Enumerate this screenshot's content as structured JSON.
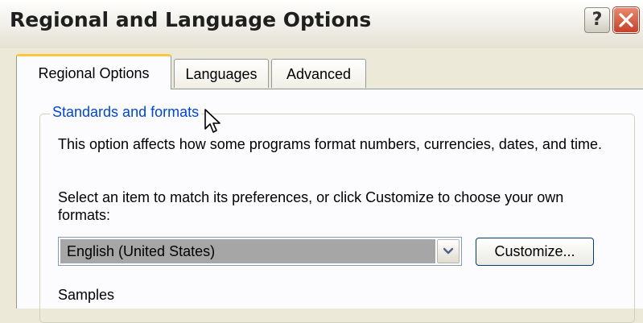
{
  "window": {
    "title": "Regional and Language Options",
    "help_label": "?",
    "help_icon": "question-mark-icon",
    "close_icon": "close-x-icon"
  },
  "tabs": [
    {
      "label": "Regional Options",
      "selected": true
    },
    {
      "label": "Languages",
      "selected": false
    },
    {
      "label": "Advanced",
      "selected": false
    }
  ],
  "standards": {
    "legend": "Standards and formats",
    "description": "This option affects how some programs format numbers, currencies, dates, and time.",
    "instruction": "Select an item to match its preferences, or click Customize to choose your own formats:",
    "selected_format": "English (United States)",
    "customize_label": "Customize...",
    "samples_label": "Samples"
  },
  "colors": {
    "accent": "#0046d5",
    "active_tab_highlight": "#ffc83c",
    "close_button": "#c6412a"
  }
}
